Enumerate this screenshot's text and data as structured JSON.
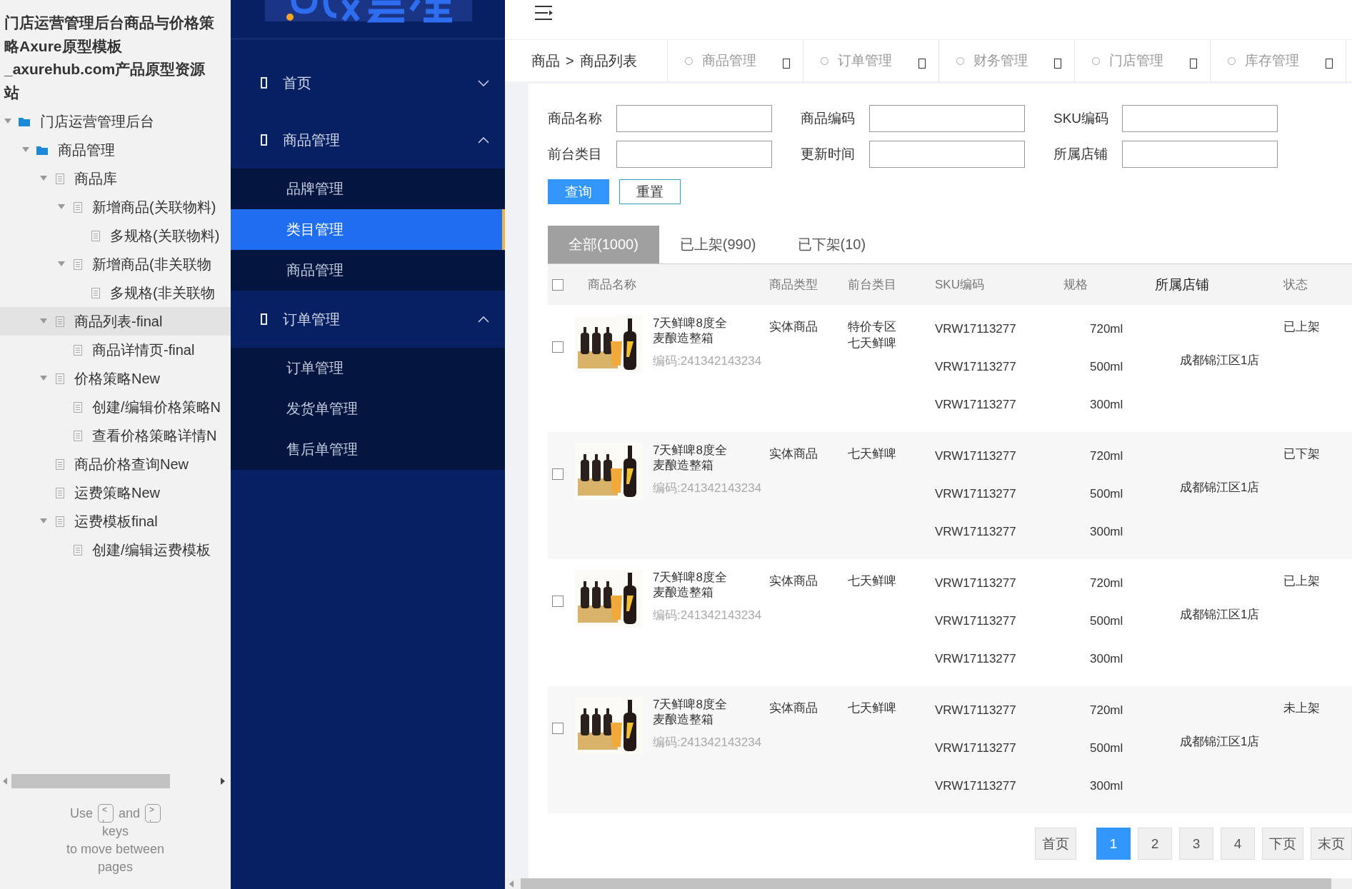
{
  "project_title": "门店运营管理后台商品与价格策略Axure原型模板_axurehub.com产品原型资源站",
  "tree": [
    {
      "label": "门店运营管理后台",
      "kind": "folder",
      "expanded": true,
      "selected": false,
      "children": [
        {
          "label": "商品管理",
          "kind": "folder",
          "expanded": true,
          "selected": false,
          "children": [
            {
              "label": "商品库",
              "kind": "page",
              "expanded": true,
              "selected": false,
              "children": [
                {
                  "label": "新增商品(关联物料)",
                  "kind": "page",
                  "expanded": true,
                  "selected": false,
                  "children": [
                    {
                      "label": "多规格(关联物料)",
                      "kind": "page",
                      "selected": false
                    }
                  ]
                },
                {
                  "label": "新增商品(非关联物",
                  "kind": "page",
                  "expanded": true,
                  "selected": false,
                  "children": [
                    {
                      "label": "多规格(非关联物",
                      "kind": "page",
                      "selected": false
                    }
                  ]
                }
              ]
            },
            {
              "label": "商品列表-final",
              "kind": "page",
              "expanded": true,
              "selected": true,
              "children": [
                {
                  "label": "商品详情页-final",
                  "kind": "page",
                  "selected": false
                }
              ]
            },
            {
              "label": "价格策略New",
              "kind": "page",
              "expanded": true,
              "selected": false,
              "children": [
                {
                  "label": "创建/编辑价格策略N",
                  "kind": "page",
                  "selected": false
                },
                {
                  "label": "查看价格策略详情N",
                  "kind": "page",
                  "selected": false
                }
              ]
            },
            {
              "label": "商品价格查询New",
              "kind": "page",
              "selected": false
            },
            {
              "label": "运费策略New",
              "kind": "page",
              "selected": false
            },
            {
              "label": "运费模板final",
              "kind": "page",
              "expanded": true,
              "selected": false,
              "children": [
                {
                  "label": "创建/编辑运费模板",
                  "kind": "page",
                  "selected": false
                }
              ]
            }
          ]
        }
      ]
    }
  ],
  "page_hint": {
    "before": "Use",
    "key_prev": [
      "<",
      ","
    ],
    "middle": "and",
    "key_next": [
      ">",
      "."
    ],
    "line1_end": "keys",
    "line2": "to move between",
    "line3": "pages"
  },
  "nav": [
    {
      "label": "首页",
      "expanded": false
    },
    {
      "label": "商品管理",
      "expanded": true,
      "children": [
        {
          "label": "品牌管理",
          "selected": false
        },
        {
          "label": "类目管理",
          "selected": true
        },
        {
          "label": "商品管理",
          "selected": false
        }
      ]
    },
    {
      "label": "订单管理",
      "expanded": true,
      "children": [
        {
          "label": "订单管理",
          "selected": false
        },
        {
          "label": "发货单管理",
          "selected": false
        },
        {
          "label": "售后单管理",
          "selected": false
        }
      ]
    }
  ],
  "breadcrumb": {
    "parent": "商品",
    "separator": ">",
    "current": "商品列表"
  },
  "open_tabs": [
    {
      "label": "商品管理"
    },
    {
      "label": "订单管理"
    },
    {
      "label": "财务管理"
    },
    {
      "label": "门店管理"
    },
    {
      "label": "库存管理"
    }
  ],
  "filters": [
    {
      "label": "商品名称"
    },
    {
      "label": "商品编码"
    },
    {
      "label": "SKU编码"
    },
    {
      "label": "前台类目"
    },
    {
      "label": "更新时间"
    },
    {
      "label": "所属店铺"
    }
  ],
  "buttons": [
    {
      "label": "查询",
      "kind": "primary"
    },
    {
      "label": "重置",
      "kind": "secondary"
    }
  ],
  "status_tabs": [
    {
      "label": "全部(1000)",
      "selected": true
    },
    {
      "label": "已上架(990)",
      "selected": false
    },
    {
      "label": "已下架(10)",
      "selected": false
    }
  ],
  "table": {
    "select_all_checked": false,
    "columns": [
      {
        "label": "商品名称",
        "highlighted": false
      },
      {
        "label": "商品类型",
        "highlighted": false
      },
      {
        "label": "前台类目",
        "highlighted": false
      },
      {
        "label": "SKU编码",
        "highlighted": false
      },
      {
        "label": "规格",
        "highlighted": false
      },
      {
        "label": "所属店铺",
        "highlighted": true
      },
      {
        "label": "状态",
        "highlighted": false
      }
    ],
    "rows": [
      {
        "checked": false,
        "name": "7天鲜啤8度全麦酿造整箱",
        "code": "编码:241342143234",
        "type": "实体商品",
        "categories": [
          "特价专区",
          "七天鲜啤"
        ],
        "skus": [
          {
            "sku": "VRW17113277",
            "spec": "720ml"
          },
          {
            "sku": "VRW17113277",
            "spec": "500ml"
          },
          {
            "sku": "VRW17113277",
            "spec": "300ml"
          }
        ],
        "store": "成都锦江区1店",
        "status": "已上架"
      },
      {
        "checked": false,
        "name": "7天鲜啤8度全麦酿造整箱",
        "code": "编码:241342143234",
        "type": "实体商品",
        "categories": [
          "七天鲜啤"
        ],
        "skus": [
          {
            "sku": "VRW17113277",
            "spec": "720ml"
          },
          {
            "sku": "VRW17113277",
            "spec": "500ml"
          },
          {
            "sku": "VRW17113277",
            "spec": "300ml"
          }
        ],
        "store": "成都锦江区1店",
        "status": "已下架"
      },
      {
        "checked": false,
        "name": "7天鲜啤8度全麦酿造整箱",
        "code": "编码:241342143234",
        "type": "实体商品",
        "categories": [
          "七天鲜啤"
        ],
        "skus": [
          {
            "sku": "VRW17113277",
            "spec": "720ml"
          },
          {
            "sku": "VRW17113277",
            "spec": "500ml"
          },
          {
            "sku": "VRW17113277",
            "spec": "300ml"
          }
        ],
        "store": "成都锦江区1店",
        "status": "已上架"
      },
      {
        "checked": false,
        "name": "7天鲜啤8度全麦酿造整箱",
        "code": "编码:241342143234",
        "type": "实体商品",
        "categories": [
          "七天鲜啤"
        ],
        "skus": [
          {
            "sku": "VRW17113277",
            "spec": "720ml"
          },
          {
            "sku": "VRW17113277",
            "spec": "500ml"
          },
          {
            "sku": "VRW17113277",
            "spec": "300ml"
          }
        ],
        "store": "成都锦江区1店",
        "status": "未上架"
      }
    ]
  },
  "pagination": [
    {
      "label": "首页",
      "selected": false
    },
    {
      "label": "1",
      "selected": true
    },
    {
      "label": "2",
      "selected": false
    },
    {
      "label": "3",
      "selected": false
    },
    {
      "label": "4",
      "selected": false
    },
    {
      "label": "下页",
      "selected": false
    },
    {
      "label": "末页",
      "selected": false
    }
  ]
}
